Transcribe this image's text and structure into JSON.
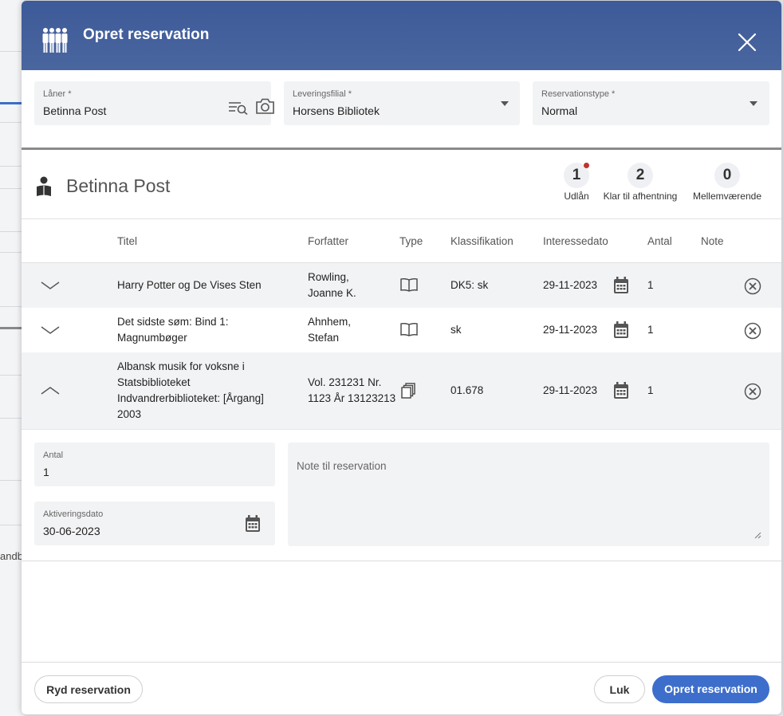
{
  "background": {
    "ghost_text": "andb"
  },
  "header": {
    "title": "Opret reservation",
    "icon": "people-group-icon"
  },
  "fields": {
    "laaner": {
      "label": "Låner *",
      "value": "Betinna Post"
    },
    "leveringsfilial": {
      "label": "Leveringsfilial *",
      "value": "Horsens Bibliotek"
    },
    "reservationstype": {
      "label": "Reservationstype *",
      "value": "Normal"
    }
  },
  "patron": {
    "name": "Betinna Post",
    "stats": [
      {
        "value": "1",
        "label": "Udlån",
        "alert": true
      },
      {
        "value": "2",
        "label": "Klar til afhentning"
      },
      {
        "value": "0",
        "label": "Mellemværende"
      }
    ]
  },
  "table": {
    "headers": [
      "Titel",
      "Forfatter",
      "Type",
      "Klassifikation",
      "Interessedato",
      "Antal",
      "Note"
    ],
    "rows": [
      {
        "title": [
          "Harry Potter og De Vises Sten"
        ],
        "author": [
          "Rowling,",
          "Joanne K."
        ],
        "type": "book-icon",
        "class": "DK5: sk",
        "date": "29-11-2023",
        "antal": "1",
        "expanded": false
      },
      {
        "title": [
          "Det sidste søm: Bind 1:",
          "Magnumbøger"
        ],
        "author": [
          "Ahnhem,",
          "Stefan"
        ],
        "type": "book-icon",
        "class": "sk",
        "date": "29-11-2023",
        "antal": "1",
        "expanded": false
      },
      {
        "title": [
          "Albansk musik for voksne i",
          "Statsbiblioteket",
          "Indvandrerbiblioteket: [Årgang]",
          "2003"
        ],
        "author": [
          "Vol. 231231 Nr.",
          "1123 År 13123213"
        ],
        "type": "periodical-icon",
        "class": "01.678",
        "date": "29-11-2023",
        "antal": "1",
        "expanded": true
      }
    ]
  },
  "detail": {
    "antal": {
      "label": "Antal",
      "value": "1"
    },
    "aktiveringsdato": {
      "label": "Aktiveringsdato",
      "value": "30-06-2023"
    },
    "note_placeholder": "Note til reservation"
  },
  "footer": {
    "clear_label": "Ryd reservation",
    "close_label": "Luk",
    "submit_label": "Opret reservation"
  },
  "colors": {
    "header": "#3d5a99",
    "primary": "#3d6ecb",
    "alert": "#c0322b"
  }
}
